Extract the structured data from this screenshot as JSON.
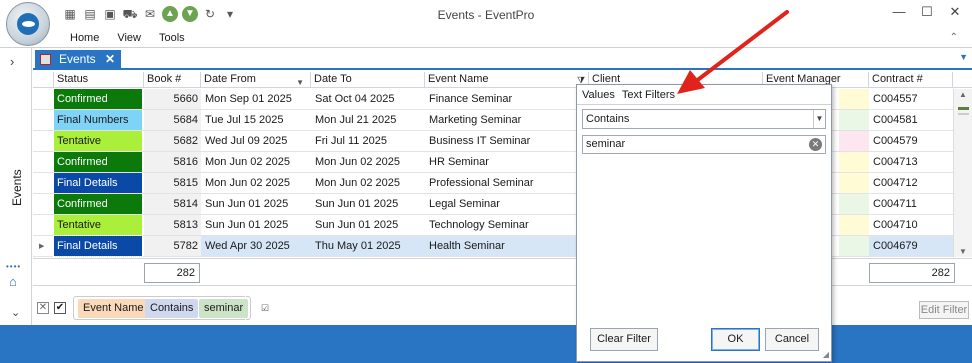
{
  "window": {
    "title": "Events - EventPro",
    "controls": {
      "minimize": "—",
      "maximize": "☐",
      "close": "✕"
    }
  },
  "quick_access": [
    "calendar-new-icon",
    "calendar-grid-icon",
    "picture-check-icon",
    "cart-check-icon",
    "mail-check-icon",
    "arrow-up-icon",
    "arrow-down-icon",
    "refresh-icon",
    "qat-dropdown-icon"
  ],
  "menu": {
    "items": [
      "Home",
      "View",
      "Tools"
    ],
    "caret": "⌃"
  },
  "sidebar": {
    "label": "Events"
  },
  "tab": {
    "label": "Events",
    "close": "✕"
  },
  "grid": {
    "columns": [
      "Status",
      "Book #",
      "Date From",
      "Date To",
      "Event Name",
      "Client",
      "Event Manager",
      "Contract #"
    ],
    "rows": [
      {
        "status": "Confirmed",
        "status_color": "#0b7a0b",
        "status_text_color": "#ffffff",
        "book": "5660",
        "date_from": "Mon Sep 01 2025",
        "date_to": "Sat Oct 04 2025",
        "event_name": "Finance Seminar",
        "contract": "C004557",
        "mgr_tint": "#fffbd4"
      },
      {
        "status": "Final Numbers",
        "status_color": "#7fd3f7",
        "status_text_color": "#1a1a1a",
        "book": "5684",
        "date_from": "Tue Jul 15 2025",
        "date_to": "Mon Jul 21 2025",
        "event_name": "Marketing Seminar",
        "contract": "C004581",
        "mgr_tint": "#eaf7e6"
      },
      {
        "status": "Tentative",
        "status_color": "#aaf03a",
        "status_text_color": "#1a1a1a",
        "book": "5682",
        "date_from": "Wed Jul 09 2025",
        "date_to": "Fri Jul 11 2025",
        "event_name": "Business IT Seminar",
        "contract": "C004579",
        "mgr_tint": "#fde6ef"
      },
      {
        "status": "Confirmed",
        "status_color": "#0b7a0b",
        "status_text_color": "#ffffff",
        "book": "5816",
        "date_from": "Mon Jun 02 2025",
        "date_to": "Mon Jun 02 2025",
        "event_name": "HR Seminar",
        "contract": "C004713",
        "mgr_tint": "#fffbd4"
      },
      {
        "status": "Final Details",
        "status_color": "#0a4aa6",
        "status_text_color": "#ffffff",
        "book": "5815",
        "date_from": "Mon Jun 02 2025",
        "date_to": "Mon Jun 02 2025",
        "event_name": "Professional Seminar",
        "contract": "C004712",
        "mgr_tint": "#fffbd4"
      },
      {
        "status": "Confirmed",
        "status_color": "#0b7a0b",
        "status_text_color": "#ffffff",
        "book": "5814",
        "date_from": "Sun Jun 01 2025",
        "date_to": "Sun Jun 01 2025",
        "event_name": "Legal Seminar",
        "contract": "C004711",
        "mgr_tint": "#eaf7e6"
      },
      {
        "status": "Tentative",
        "status_color": "#aaf03a",
        "status_text_color": "#1a1a1a",
        "book": "5813",
        "date_from": "Sun Jun 01 2025",
        "date_to": "Sun Jun 01 2025",
        "event_name": "Technology Seminar",
        "contract": "C004710",
        "mgr_tint": "#fffbd4"
      },
      {
        "status": "Final Details",
        "status_color": "#0a4aa6",
        "status_text_color": "#ffffff",
        "book": "5782",
        "date_from": "Wed Apr 30 2025",
        "date_to": "Thu May 01 2025",
        "event_name": "Health Seminar",
        "contract": "C004679",
        "mgr_tint": "#eaf7e6",
        "selected": true
      }
    ],
    "totals": {
      "book_count": "282",
      "contract_count": "282"
    }
  },
  "filter_bar": {
    "chip_field": "Event Name",
    "chip_operator": "Contains",
    "chip_value": "seminar",
    "edit_button": "Edit Filter"
  },
  "filter_popup": {
    "tab_values": "Values",
    "tab_text_filters": "Text Filters",
    "operator": "Contains",
    "search_value": "seminar",
    "clear_button": "Clear Filter",
    "ok_button": "OK",
    "cancel_button": "Cancel"
  },
  "colors": {
    "accent": "#2a74c4",
    "annotation_arrow": "#e0241b"
  }
}
